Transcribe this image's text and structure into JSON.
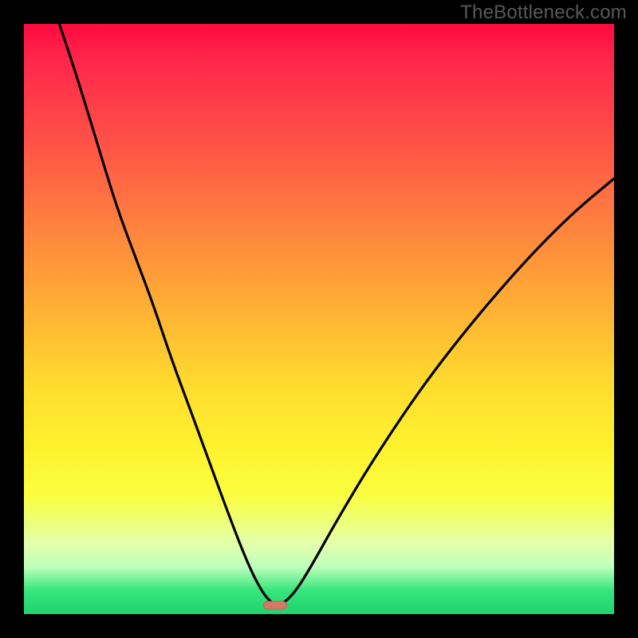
{
  "watermark": "TheBottleneck.com",
  "chart_data": {
    "type": "line",
    "title": "",
    "xlabel": "",
    "ylabel": "",
    "xlim": [
      0,
      1
    ],
    "ylim": [
      0,
      1
    ],
    "background_gradient": {
      "top": "#ff0a3f",
      "bottom": "#21d36e",
      "stops": [
        "#ff0a3f",
        "#ff264a",
        "#ff4b48",
        "#ff7a40",
        "#ffb034",
        "#ffde2e",
        "#fff22e",
        "#f9ff40",
        "#e4ffab",
        "#bfffbc",
        "#35e57c",
        "#21d36e"
      ]
    },
    "minimum": {
      "x": 0.425,
      "y": 0.985
    },
    "marker_color": "#d77867",
    "series": [
      {
        "name": "bottleneck-curve",
        "color": "#000000",
        "points": [
          {
            "x": 0.06,
            "y": 0.0
          },
          {
            "x": 0.085,
            "y": 0.075
          },
          {
            "x": 0.11,
            "y": 0.155
          },
          {
            "x": 0.135,
            "y": 0.238
          },
          {
            "x": 0.16,
            "y": 0.318
          },
          {
            "x": 0.19,
            "y": 0.398
          },
          {
            "x": 0.22,
            "y": 0.478
          },
          {
            "x": 0.25,
            "y": 0.568
          },
          {
            "x": 0.285,
            "y": 0.662
          },
          {
            "x": 0.32,
            "y": 0.758
          },
          {
            "x": 0.352,
            "y": 0.845
          },
          {
            "x": 0.38,
            "y": 0.916
          },
          {
            "x": 0.402,
            "y": 0.96
          },
          {
            "x": 0.418,
            "y": 0.98
          },
          {
            "x": 0.43,
            "y": 0.985
          },
          {
            "x": 0.445,
            "y": 0.978
          },
          {
            "x": 0.465,
            "y": 0.955
          },
          {
            "x": 0.492,
            "y": 0.91
          },
          {
            "x": 0.53,
            "y": 0.842
          },
          {
            "x": 0.575,
            "y": 0.766
          },
          {
            "x": 0.625,
            "y": 0.688
          },
          {
            "x": 0.68,
            "y": 0.608
          },
          {
            "x": 0.74,
            "y": 0.53
          },
          {
            "x": 0.805,
            "y": 0.452
          },
          {
            "x": 0.87,
            "y": 0.38
          },
          {
            "x": 0.935,
            "y": 0.316
          },
          {
            "x": 1.0,
            "y": 0.262
          }
        ]
      }
    ]
  }
}
